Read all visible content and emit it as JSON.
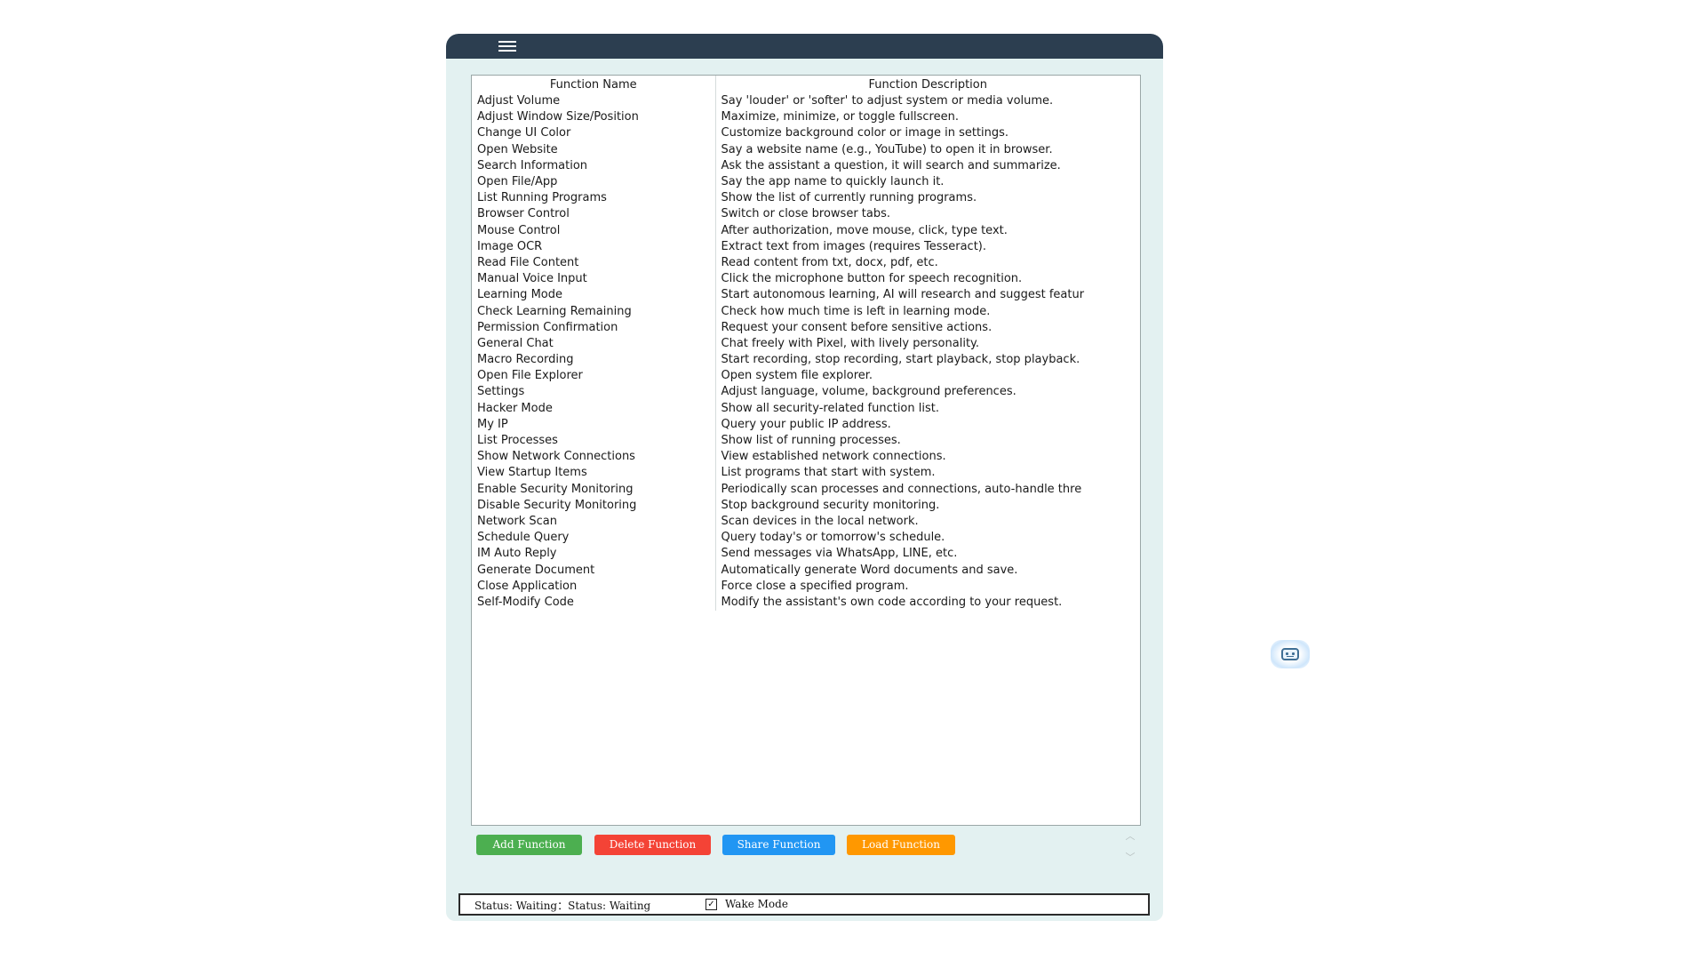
{
  "table": {
    "headers": [
      "Function Name",
      "Function Description"
    ],
    "rows": [
      [
        "Adjust Volume",
        "Say 'louder' or 'softer' to adjust system or media volume."
      ],
      [
        "Adjust Window Size/Position",
        "Maximize, minimize, or toggle fullscreen."
      ],
      [
        "Change UI Color",
        "Customize background color or image in settings."
      ],
      [
        "Open Website",
        "Say a website name (e.g., YouTube) to open it in browser."
      ],
      [
        "Search Information",
        "Ask the assistant a question, it will search and summarize."
      ],
      [
        "Open File/App",
        "Say the app name to quickly launch it."
      ],
      [
        "List Running Programs",
        "Show the list of currently running programs."
      ],
      [
        "Browser Control",
        "Switch or close browser tabs."
      ],
      [
        "Mouse Control",
        "After authorization, move mouse, click, type text."
      ],
      [
        "Image OCR",
        "Extract text from images (requires Tesseract)."
      ],
      [
        "Read File Content",
        "Read content from txt, docx, pdf, etc."
      ],
      [
        "Manual Voice Input",
        "Click the microphone button for speech recognition."
      ],
      [
        "Learning Mode",
        "Start autonomous learning, AI will research and suggest featur"
      ],
      [
        "Check Learning Remaining",
        "Check how much time is left in learning mode."
      ],
      [
        "Permission Confirmation",
        "Request your consent before sensitive actions."
      ],
      [
        "General Chat",
        "Chat freely with Pixel, with lively personality."
      ],
      [
        "Macro Recording",
        "Start recording, stop recording, start playback, stop playback."
      ],
      [
        "Open File Explorer",
        "Open system file explorer."
      ],
      [
        "Settings",
        "Adjust language, volume, background preferences."
      ],
      [
        "Hacker Mode",
        "Show all security-related function list."
      ],
      [
        "My IP",
        "Query your public IP address."
      ],
      [
        "List Processes",
        "Show list of running processes."
      ],
      [
        "Show Network Connections",
        "View established network connections."
      ],
      [
        "View Startup Items",
        "List programs that start with system."
      ],
      [
        "Enable Security Monitoring",
        "Periodically scan processes and connections, auto-handle thre"
      ],
      [
        "Disable Security Monitoring",
        "Stop background security monitoring."
      ],
      [
        "Network Scan",
        "Scan devices in the local network."
      ],
      [
        "Schedule Query",
        "Query today's or tomorrow's schedule."
      ],
      [
        "IM Auto Reply",
        "Send messages via WhatsApp, LINE, etc."
      ],
      [
        "Generate Document",
        "Automatically generate Word documents and save."
      ],
      [
        "Close Application",
        "Force close a specified program."
      ],
      [
        "Self-Modify Code",
        "Modify the assistant's own code according to your request."
      ]
    ]
  },
  "buttons": {
    "add": "Add Function",
    "delete": "Delete Function",
    "share": "Share Function",
    "load": "Load Function"
  },
  "scroll": {
    "up": "︿",
    "down": "﹀"
  },
  "status": {
    "text": "Status: Waiting：Status: Waiting",
    "wake_label": "Wake Mode",
    "wake_checked": "✓"
  },
  "icons": {
    "menu": "hamburger-menu-icon",
    "robot": "robot-icon"
  },
  "colors": {
    "titlebar": "#2c3e50",
    "window_bg": "#e3f1f1",
    "add": "#4caf50",
    "delete": "#f44336",
    "share": "#2196f3",
    "load": "#ff9800"
  }
}
